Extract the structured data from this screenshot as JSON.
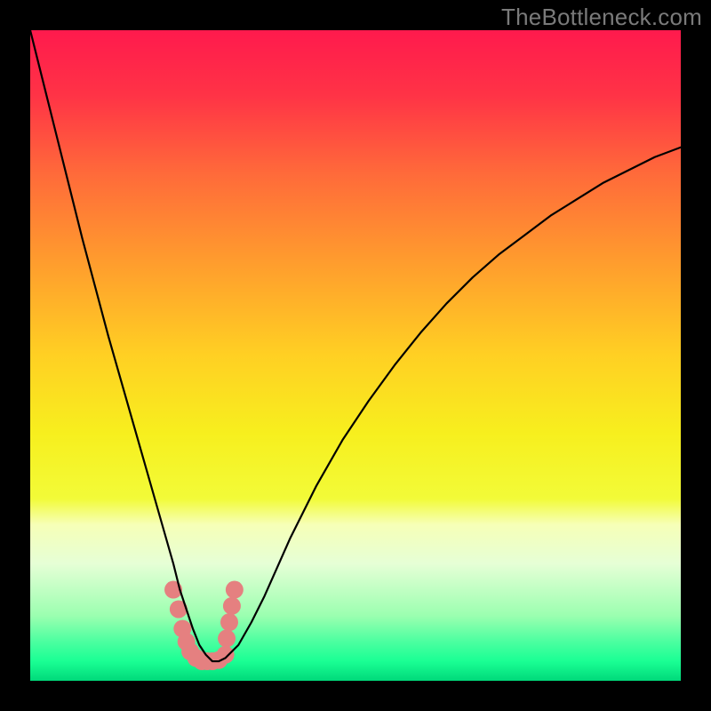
{
  "watermark": "TheBottleneck.com",
  "gradient": {
    "stops": [
      {
        "offset": 0.0,
        "color": "#ff1a4d"
      },
      {
        "offset": 0.1,
        "color": "#ff3346"
      },
      {
        "offset": 0.22,
        "color": "#ff6a3a"
      },
      {
        "offset": 0.35,
        "color": "#ff9a2e"
      },
      {
        "offset": 0.5,
        "color": "#ffd023"
      },
      {
        "offset": 0.62,
        "color": "#f7ef1e"
      },
      {
        "offset": 0.72,
        "color": "#f2fb38"
      },
      {
        "offset": 0.76,
        "color": "#f6ffb7"
      },
      {
        "offset": 0.82,
        "color": "#e6ffd6"
      },
      {
        "offset": 0.9,
        "color": "#9bffb0"
      },
      {
        "offset": 0.94,
        "color": "#4bffa0"
      },
      {
        "offset": 0.97,
        "color": "#1aff94"
      },
      {
        "offset": 1.0,
        "color": "#00d97a"
      }
    ]
  },
  "chart_data": {
    "type": "line",
    "title": "",
    "xlabel": "",
    "ylabel": "",
    "xlim": [
      0,
      100
    ],
    "ylim": [
      0,
      100
    ],
    "x": [
      0,
      2,
      4,
      6,
      8,
      10,
      12,
      14,
      16,
      18,
      20,
      22,
      23,
      24,
      25,
      26,
      27,
      28,
      29,
      30,
      32,
      34,
      36,
      38,
      40,
      44,
      48,
      52,
      56,
      60,
      64,
      68,
      72,
      76,
      80,
      84,
      88,
      92,
      96,
      100
    ],
    "values": [
      100,
      92,
      84,
      76,
      68,
      60.5,
      53,
      46,
      39,
      32,
      25,
      18,
      14,
      11,
      8,
      5.5,
      4,
      3,
      3,
      3.5,
      5.5,
      9,
      13,
      17.5,
      22,
      30,
      37,
      43,
      48.5,
      53.5,
      58,
      62,
      65.5,
      68.5,
      71.5,
      74,
      76.5,
      78.5,
      80.5,
      82
    ],
    "minimum_x": 27.5,
    "marker_cluster": {
      "color": "#e58080",
      "points": [
        {
          "x": 22.0,
          "y": 14.0
        },
        {
          "x": 22.8,
          "y": 11.0
        },
        {
          "x": 23.4,
          "y": 8.0
        },
        {
          "x": 24.0,
          "y": 6.0
        },
        {
          "x": 24.6,
          "y": 4.5
        },
        {
          "x": 25.5,
          "y": 3.5
        },
        {
          "x": 26.4,
          "y": 3.0
        },
        {
          "x": 27.2,
          "y": 3.0
        },
        {
          "x": 28.0,
          "y": 3.0
        },
        {
          "x": 29.0,
          "y": 3.2
        },
        {
          "x": 30.0,
          "y": 4.0
        },
        {
          "x": 30.2,
          "y": 6.5
        },
        {
          "x": 30.6,
          "y": 9.0
        },
        {
          "x": 31.0,
          "y": 11.5
        },
        {
          "x": 31.4,
          "y": 14.0
        }
      ]
    }
  }
}
